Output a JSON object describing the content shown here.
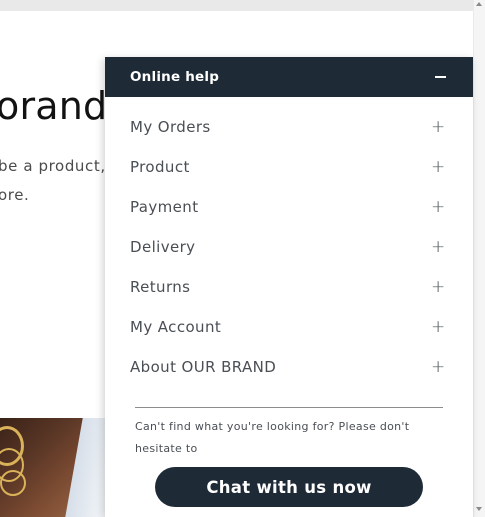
{
  "background": {
    "heading": "orand",
    "text_line1": "be a product, m",
    "text_line2": "ore."
  },
  "help_widget": {
    "title": "Online help",
    "items": [
      {
        "label": "My Orders"
      },
      {
        "label": "Product"
      },
      {
        "label": "Payment"
      },
      {
        "label": "Delivery"
      },
      {
        "label": "Returns"
      },
      {
        "label": "My Account"
      },
      {
        "label": "About OUR BRAND"
      }
    ],
    "expand_symbol": "+",
    "note": "Can't find what you're looking for? Please don't hesitate to",
    "chat_button_label": "Chat with us now"
  },
  "colors": {
    "panel_dark": "#1f2a37",
    "text_muted": "#4a4f55"
  },
  "icons": [
    "minimize-icon",
    "plus-icon"
  ]
}
